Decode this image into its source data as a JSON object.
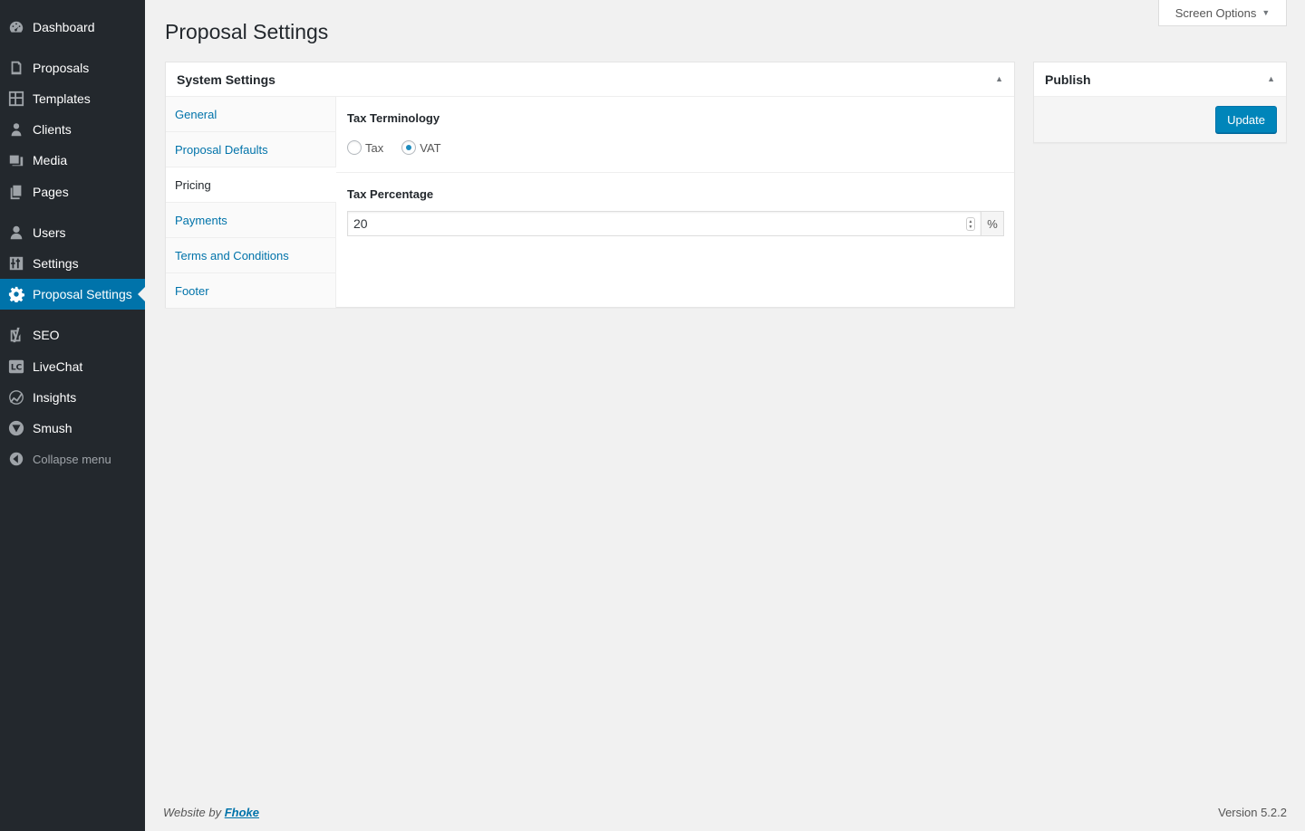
{
  "sidebar": {
    "items": [
      {
        "label": "Dashboard",
        "icon": "dashboard-icon"
      },
      {
        "label": "Proposals",
        "icon": "proposals-icon"
      },
      {
        "label": "Templates",
        "icon": "templates-icon"
      },
      {
        "label": "Clients",
        "icon": "clients-icon"
      },
      {
        "label": "Media",
        "icon": "media-icon"
      },
      {
        "label": "Pages",
        "icon": "pages-icon"
      },
      {
        "label": "Users",
        "icon": "users-icon"
      },
      {
        "label": "Settings",
        "icon": "settings-icon"
      },
      {
        "label": "Proposal Settings",
        "icon": "gear-icon"
      },
      {
        "label": "SEO",
        "icon": "seo-icon"
      },
      {
        "label": "LiveChat",
        "icon": "livechat-icon"
      },
      {
        "label": "Insights",
        "icon": "insights-icon"
      },
      {
        "label": "Smush",
        "icon": "smush-icon"
      }
    ],
    "collapse_label": "Collapse menu",
    "accent": "#0073aa",
    "background": "#23282d"
  },
  "screen_options": {
    "label": "Screen Options"
  },
  "page": {
    "title": "Proposal Settings"
  },
  "system_settings": {
    "title": "System Settings",
    "tabs": [
      {
        "label": "General"
      },
      {
        "label": "Proposal Defaults"
      },
      {
        "label": "Pricing"
      },
      {
        "label": "Payments"
      },
      {
        "label": "Terms and Conditions"
      },
      {
        "label": "Footer"
      }
    ],
    "active_tab": "Pricing",
    "tax_terminology": {
      "label": "Tax Terminology",
      "options": [
        {
          "label": "Tax",
          "checked": false
        },
        {
          "label": "VAT",
          "checked": true
        }
      ]
    },
    "tax_percentage": {
      "label": "Tax Percentage",
      "value": "20",
      "addon": "%"
    }
  },
  "publish": {
    "title": "Publish",
    "update_label": "Update"
  },
  "footer": {
    "prefix": "Website by",
    "link": "Fhoke",
    "version": "Version 5.2.2"
  }
}
